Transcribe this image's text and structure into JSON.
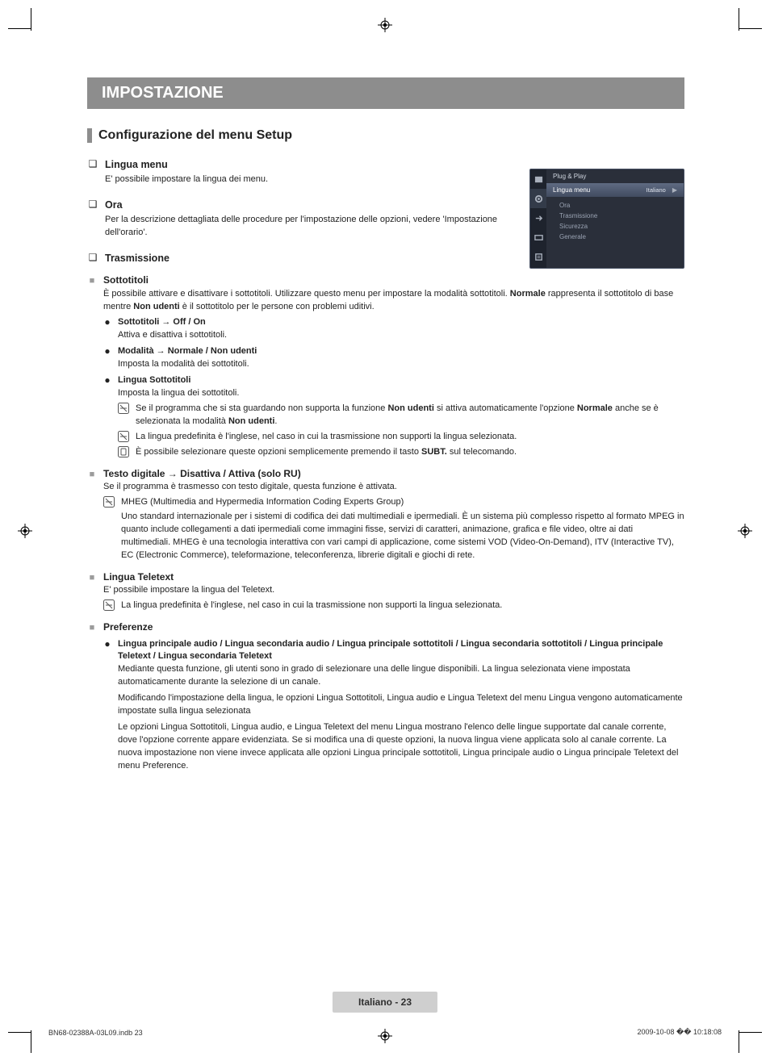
{
  "title_bar": "IMPOSTAZIONE",
  "h2": "Configurazione del menu Setup",
  "lingua_menu": {
    "title": "Lingua menu",
    "desc": "E' possibile impostare la lingua dei menu."
  },
  "ora": {
    "title": "Ora",
    "desc": "Per la descrizione dettagliata delle procedure per l'impostazione delle opzioni, vedere 'Impostazione dell'orario'."
  },
  "trasmissione": {
    "title": "Trasmissione"
  },
  "sottotitoli": {
    "title": "Sottotitoli",
    "desc_a": "È possibile attivare e disattivare i sottotitoli. Utilizzare questo menu per impostare la modalità sottotitoli. ",
    "desc_b": "Normale",
    "desc_c": " rappresenta il sottotitolo di base mentre ",
    "desc_d": "Non udenti",
    "desc_e": " è il sottotitolo per le persone con problemi uditivi.",
    "li1_t": "Sottotitoli → Off / On",
    "li1_d": "Attiva e disattiva i sottotitoli.",
    "li2_t": "Modalità → Normale / Non udenti",
    "li2_d": "Imposta la modalità dei sottotitoli.",
    "li3_t": "Lingua Sottotitoli",
    "li3_d": "Imposta la lingua dei sottotitoli.",
    "n1_a": "Se il programma che si sta guardando non supporta la funzione ",
    "n1_b": "Non udenti",
    "n1_c": " si attiva automaticamente l'opzione ",
    "n1_d": "Normale",
    "n1_e": " anche se è selezionata la modalità ",
    "n1_f": "Non udenti",
    "n1_g": ".",
    "n2": "La lingua predefinita è l'inglese, nel caso in cui la trasmissione non supporti la lingua selezionata.",
    "n3_a": "È possibile selezionare queste opzioni semplicemente premendo il tasto ",
    "n3_b": "SUBT.",
    "n3_c": " sul telecomando."
  },
  "testodig": {
    "title": "Testo digitale → Disattiva / Attiva (solo RU)",
    "d1": "Se il programma è trasmesso con testo digitale, questa funzione è attivata.",
    "n1": "MHEG (Multimedia and Hypermedia Information Coding Experts Group)",
    "d2": "Uno standard internazionale per i sistemi di codifica dei dati multimediali e ipermediali. È un sistema più complesso rispetto al formato MPEG in quanto include collegamenti a dati ipermediali come immagini fisse, servizi di caratteri, animazione, grafica e file video, oltre ai dati multimediali. MHEG è una tecnologia interattiva con vari campi di applicazione, come sistemi VOD (Video-On-Demand), ITV (Interactive TV), EC (Electronic Commerce), teleformazione, teleconferenza, librerie digitali e giochi di rete."
  },
  "teletext": {
    "title": "Lingua Teletext",
    "d1": "E' possibile impostare la lingua del Teletext.",
    "n1": "La lingua predefinita è l'inglese, nel caso in cui la trasmissione non supporti la lingua selezionata."
  },
  "preferenze": {
    "title": "Preferenze",
    "li_t": "Lingua principale audio / Lingua secondaria audio / Lingua principale sottotitoli / Lingua secondaria sottotitoli / Lingua principale Teletext / Lingua secondaria Teletext",
    "p1": "Mediante questa funzione, gli utenti sono in grado di selezionare una delle lingue disponibili. La lingua selezionata viene impostata automaticamente durante la selezione di un canale.",
    "p2": "Modificando l'impostazione della lingua, le opzioni Lingua Sottotitoli, Lingua audio e Lingua Teletext del menu Lingua vengono automaticamente impostate sulla lingua selezionata",
    "p3": "Le opzioni Lingua Sottotitoli, Lingua audio, e Lingua Teletext del menu Lingua mostrano l'elenco delle lingue supportate dal canale corrente, dove l'opzione corrente appare evidenziata. Se si modifica una di queste opzioni, la nuova lingua viene applicata solo al canale corrente. La nuova impostazione non viene invece applicata alle opzioni Lingua principale sottotitoli, Lingua principale audio o Lingua principale Teletext del menu Preference."
  },
  "osd": {
    "vert": "Impostazione",
    "r0": "Plug & Play",
    "r1": "Lingua menu",
    "r1v": "Italiano",
    "list": [
      "Ora",
      "Trasmissione",
      "Sicurezza",
      "Generale"
    ]
  },
  "footer_pill": "Italiano - 23",
  "footer_left": "BN68-02388A-03L09.indb   23",
  "footer_right": "2009-10-08   �� 10:18:08"
}
